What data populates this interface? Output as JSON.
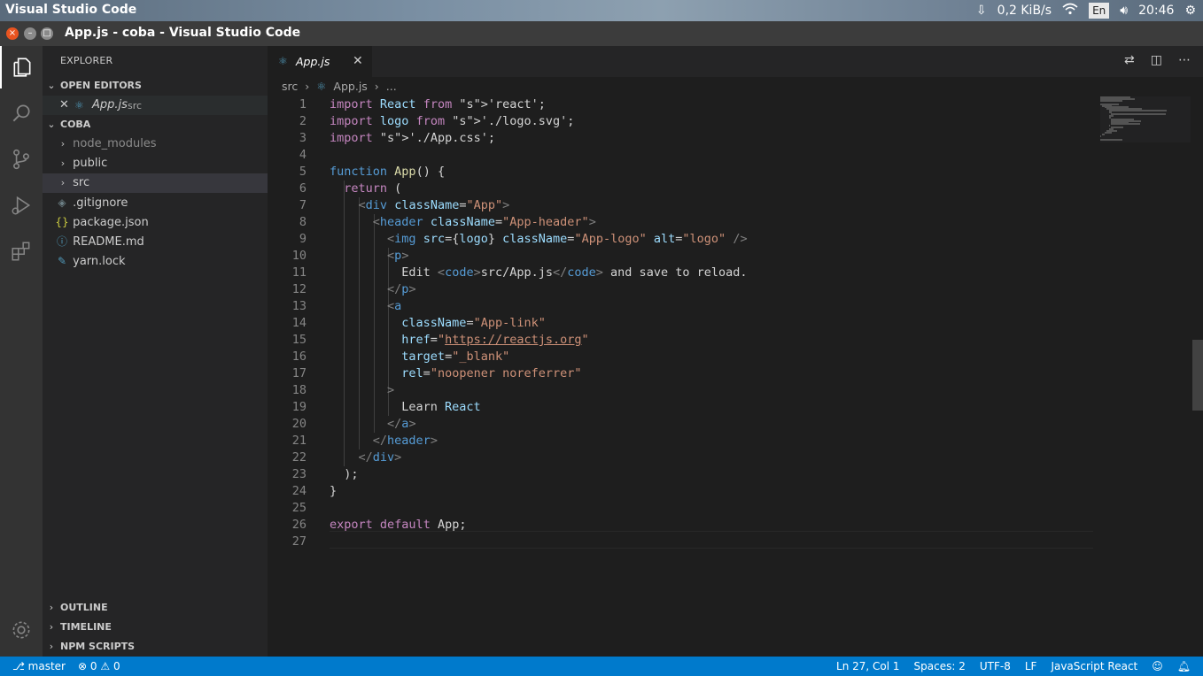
{
  "os_bar": {
    "app_name": "Visual Studio Code",
    "net_speed": "0,2 KiB/s",
    "keyboard_lang": "En",
    "clock": "20:46"
  },
  "window": {
    "title": "App.js - coba - Visual Studio Code"
  },
  "sidebar": {
    "title": "EXPLORER",
    "open_editors_label": "OPEN EDITORS",
    "open_file_name": "App.js",
    "open_file_dir": "src",
    "folder_label": "COBA",
    "tree": [
      {
        "name": "node_modules",
        "type": "folder",
        "dim": true
      },
      {
        "name": "public",
        "type": "folder"
      },
      {
        "name": "src",
        "type": "folder",
        "selected": true
      },
      {
        "name": ".gitignore",
        "type": "file",
        "icon": "git-icon"
      },
      {
        "name": "package.json",
        "type": "file",
        "icon": "json-icon"
      },
      {
        "name": "README.md",
        "type": "file",
        "icon": "info-icon"
      },
      {
        "name": "yarn.lock",
        "type": "file",
        "icon": "yarn-icon"
      }
    ],
    "bottom_sections": [
      "OUTLINE",
      "TIMELINE",
      "NPM SCRIPTS"
    ]
  },
  "tab": {
    "name": "App.js",
    "close": "✕"
  },
  "breadcrumb": {
    "folder": "src",
    "file": "App.js",
    "more": "..."
  },
  "code": {
    "line_numbers": [
      "1",
      "2",
      "3",
      "4",
      "5",
      "6",
      "7",
      "8",
      "9",
      "10",
      "11",
      "12",
      "13",
      "14",
      "15",
      "16",
      "17",
      "18",
      "19",
      "20",
      "21",
      "22",
      "23",
      "24",
      "25",
      "26",
      "27"
    ],
    "lines": [
      "import React from 'react';",
      "import logo from './logo.svg';",
      "import './App.css';",
      "",
      "function App() {",
      "  return (",
      "    <div className=\"App\">",
      "      <header className=\"App-header\">",
      "        <img src={logo} className=\"App-logo\" alt=\"logo\" />",
      "        <p>",
      "          Edit <code>src/App.js</code> and save to reload.",
      "        </p>",
      "        <a",
      "          className=\"App-link\"",
      "          href=\"https://reactjs.org\"",
      "          target=\"_blank\"",
      "          rel=\"noopener noreferrer\"",
      "        >",
      "          Learn React",
      "        </a>",
      "      </header>",
      "    </div>",
      "  );",
      "}",
      "",
      "export default App;",
      ""
    ]
  },
  "statusbar": {
    "branch": "master",
    "errors": "0",
    "warnings": "0",
    "cursor": "Ln 27, Col 1",
    "spaces": "Spaces: 2",
    "encoding": "UTF-8",
    "eol": "LF",
    "language": "JavaScript React"
  },
  "colors": {
    "statusbar": "#007acc",
    "accent_close": "#e95420",
    "editor_bg": "#1e1e1e"
  }
}
